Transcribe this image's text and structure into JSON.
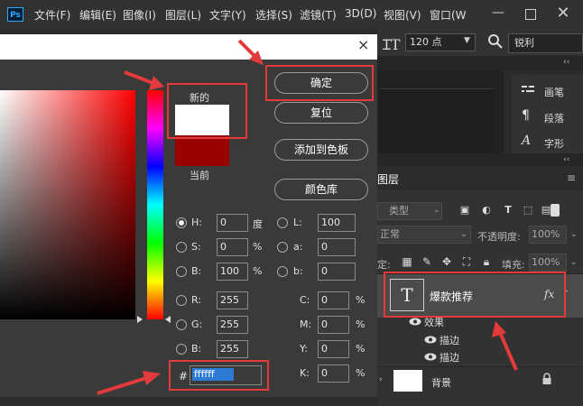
{
  "menubar": {
    "logo": "Ps",
    "items": [
      "文件(F)",
      "编辑(E)",
      "图像(I)",
      "图层(L)",
      "文字(Y)",
      "选择(S)",
      "滤镜(T)",
      "3D(D)",
      "视图(V)",
      "窗口(W"
    ],
    "min_symbol": "—",
    "close_symbol": "✕"
  },
  "options_bar": {
    "text_tool_icon": "ꞮT",
    "font_size": "120 点",
    "antialias": "锐利"
  },
  "side_panel": {
    "items": [
      {
        "icon": "brush-icon",
        "label": "画笔"
      },
      {
        "icon": "paragraph-icon",
        "label": "段落"
      },
      {
        "icon": "character-icon",
        "label": "字形"
      }
    ]
  },
  "layers": {
    "tab_title": "图层",
    "tab_partial": "图层",
    "filter_kind": "类型",
    "blend_mode": "正常",
    "blend_partial": "正常",
    "opacity_label": "不透明度:",
    "opacity_value": "100%",
    "lock_label": "锁定:",
    "lock_partial": "定:",
    "fill_label": "填充:",
    "fill_value": "100%",
    "text_layer": {
      "thumb": "T",
      "name": "爆款推荐",
      "fx": "fx"
    },
    "effects_label": "效果",
    "stroke1": "描边",
    "stroke2": "描边",
    "background_layer": "背景"
  },
  "dialog": {
    "close_symbol": "×",
    "new_label": "新的",
    "current_label": "当前",
    "buttons": {
      "ok": "确定",
      "reset": "复位",
      "add_to_swatches": "添加到色板",
      "color_libraries": "颜色库"
    },
    "fields": {
      "H": {
        "label": "H:",
        "value": "0",
        "unit": "度"
      },
      "S": {
        "label": "S:",
        "value": "0",
        "unit": "%"
      },
      "B": {
        "label": "B:",
        "value": "100",
        "unit": "%"
      },
      "R": {
        "label": "R:",
        "value": "255"
      },
      "G": {
        "label": "G:",
        "value": "255"
      },
      "Bb": {
        "label": "B:",
        "value": "255"
      },
      "L": {
        "label": "L:",
        "value": "100"
      },
      "a": {
        "label": "a:",
        "value": "0"
      },
      "b": {
        "label": "b:",
        "value": "0"
      },
      "C": {
        "label": "C:",
        "value": "0",
        "unit": "%"
      },
      "M": {
        "label": "M:",
        "value": "0",
        "unit": "%"
      },
      "Y": {
        "label": "Y:",
        "value": "0",
        "unit": "%"
      },
      "K": {
        "label": "K:",
        "value": "0",
        "unit": "%"
      }
    },
    "hex_hash": "#",
    "hex_value": "ffffff",
    "new_color": "#ffffff",
    "current_color": "#990000"
  },
  "colors": {
    "annotation_red": "#e33b3b",
    "selection_blue": "#2e7bd6"
  }
}
